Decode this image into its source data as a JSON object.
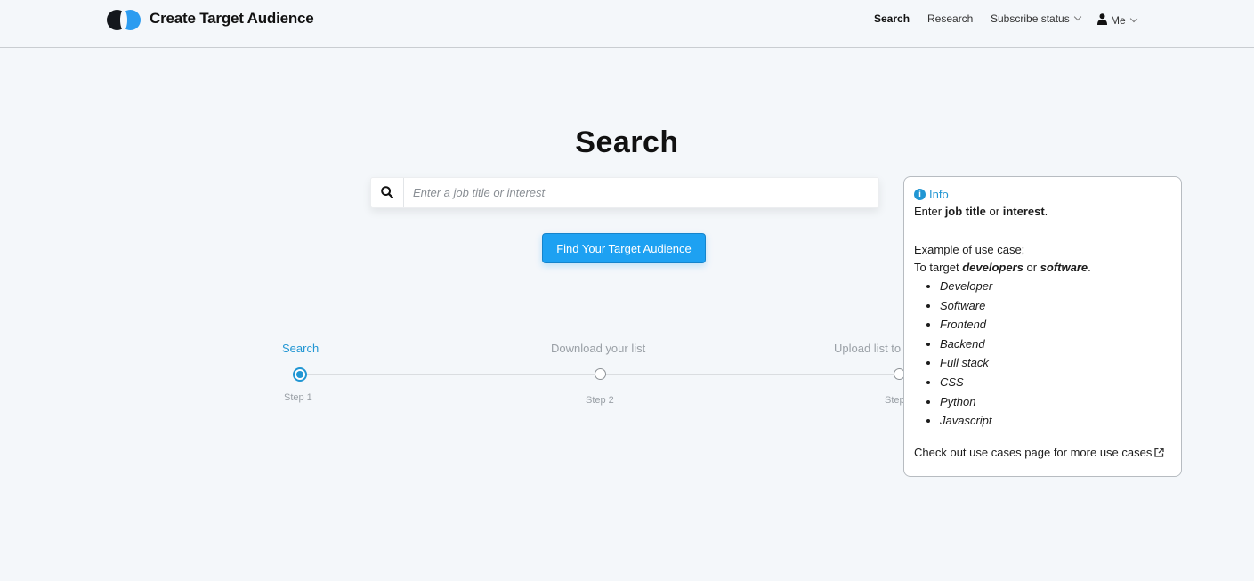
{
  "header": {
    "brand": "Create Target Audience",
    "nav": {
      "search": "Search",
      "research": "Research",
      "subscribe": "Subscribe status",
      "me": "Me"
    }
  },
  "main": {
    "title": "Search",
    "search_placeholder": "Enter a job title or interest",
    "search_value": "",
    "cta": "Find Your Target Audience"
  },
  "steps": [
    {
      "label": "Search",
      "sub": "Step 1",
      "active": true
    },
    {
      "label": "Download your list",
      "sub": "Step 2",
      "active": false
    },
    {
      "label": "Upload list to",
      "sub": "Step",
      "active": false
    }
  ],
  "info": {
    "heading": "Info",
    "intro": {
      "a": "Enter ",
      "b": "job title",
      "c": " or ",
      "d": "interest",
      "e": "."
    },
    "example_label": "Example of use case;",
    "target": {
      "a": "To target ",
      "b": "developers",
      "c": " or ",
      "d": "software",
      "e": "."
    },
    "examples": [
      "Developer",
      "Software",
      "Frontend",
      "Backend",
      "Full stack",
      "CSS",
      "Python",
      "Javascript"
    ],
    "footer": "Check out use cases page for more use cases"
  },
  "colors": {
    "accent": "#1da1f2",
    "step_active": "#2196d3",
    "background": "#f4f7fa"
  },
  "icons": [
    "search-icon",
    "user-icon",
    "chevron-down-icon",
    "info-icon",
    "external-link-icon"
  ]
}
